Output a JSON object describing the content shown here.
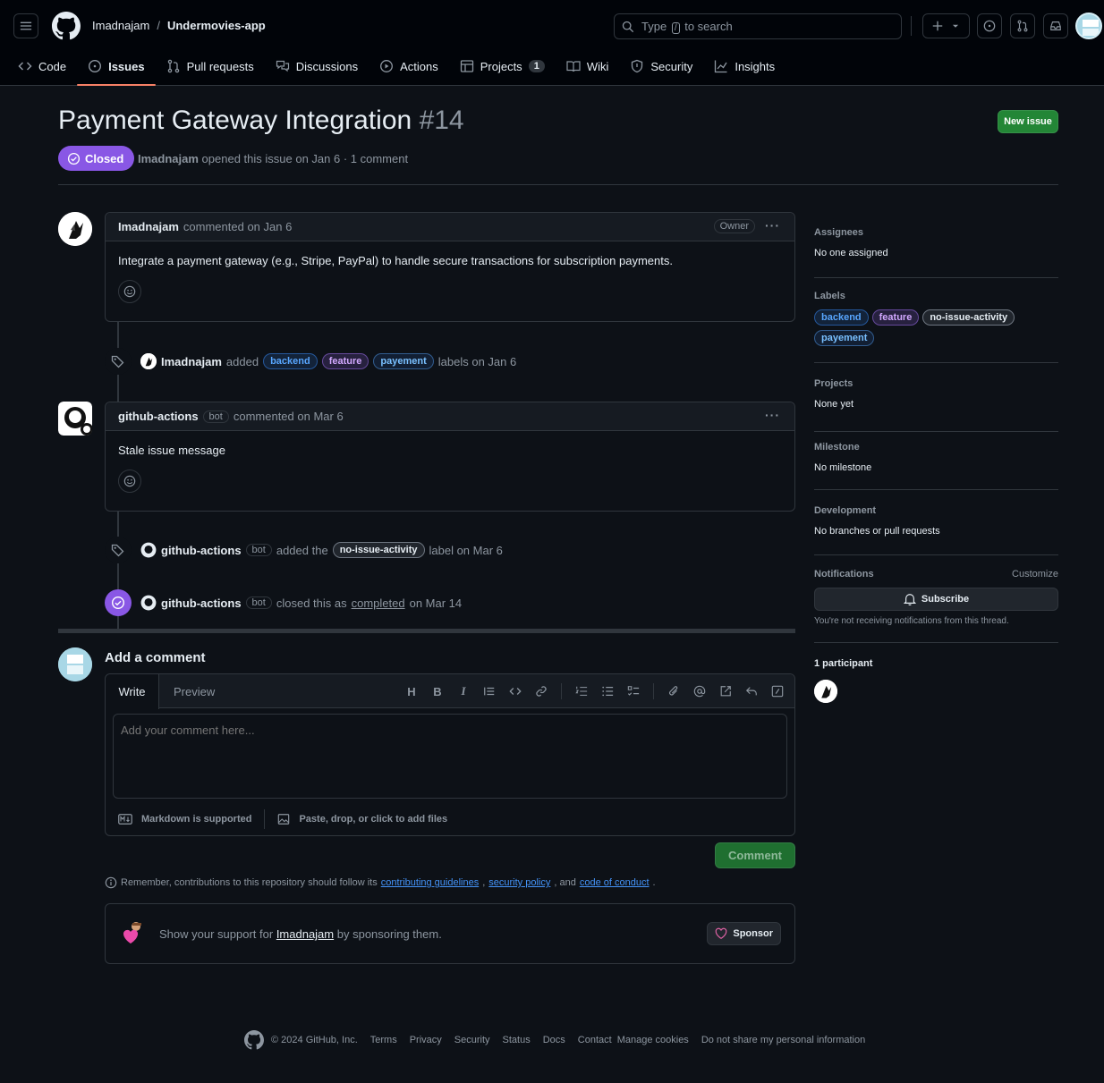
{
  "header": {
    "owner": "Imadnajam",
    "separator": "/",
    "repo": "Undermovies-app",
    "search_prefix": "Type",
    "search_key": "/",
    "search_suffix": "to search"
  },
  "repo_nav": [
    {
      "label": "Code",
      "icon": "code-icon"
    },
    {
      "label": "Issues",
      "icon": "issue-opened-icon",
      "active": true
    },
    {
      "label": "Pull requests",
      "icon": "git-pull-request-icon"
    },
    {
      "label": "Discussions",
      "icon": "comment-discussion-icon"
    },
    {
      "label": "Actions",
      "icon": "play-icon"
    },
    {
      "label": "Projects",
      "icon": "table-icon",
      "count": "1"
    },
    {
      "label": "Wiki",
      "icon": "book-icon"
    },
    {
      "label": "Security",
      "icon": "shield-icon"
    },
    {
      "label": "Insights",
      "icon": "graph-icon"
    }
  ],
  "issue": {
    "title": "Payment Gateway Integration",
    "number": "#14",
    "new_issue_label": "New issue",
    "state": "Closed",
    "meta_author": "Imadnajam",
    "meta_rest": "opened this issue on Jan 6 · 1 comment"
  },
  "timeline": {
    "first_comment": {
      "author": "Imadnajam",
      "when": "commented on Jan 6",
      "role": "Owner",
      "body": "Integrate a payment gateway (e.g., Stripe, PayPal) to handle secure transactions for subscription payments."
    },
    "labels_event": {
      "actor": "Imadnajam",
      "verb": "added",
      "labels": [
        "backend",
        "feature",
        "payement"
      ],
      "tail": "labels on Jan 6"
    },
    "bot_comment": {
      "author": "github-actions",
      "badge": "bot",
      "when": "commented on Mar 6",
      "body": "Stale issue message"
    },
    "stale_event": {
      "actor": "github-actions",
      "badge": "bot",
      "verb": "added the",
      "label": "no-issue-activity",
      "tail": "label on Mar 6"
    },
    "closed_event": {
      "actor": "github-actions",
      "badge": "bot",
      "verb": "closed this as",
      "reason": "completed",
      "tail": "on Mar 14"
    }
  },
  "composer": {
    "title": "Add a comment",
    "tab_write": "Write",
    "tab_preview": "Preview",
    "placeholder": "Add your comment here...",
    "markdown_note": "Markdown is supported",
    "attach_note": "Paste, drop, or click to add files",
    "submit_label": "Comment",
    "heading_glyph": "H",
    "bold_glyph": "B",
    "italic_glyph": "I"
  },
  "contrib_note": {
    "prefix": "Remember, contributions to this repository should follow its",
    "link1": "contributing guidelines",
    "comma1": ",",
    "link2": "security policy",
    "and": ", and",
    "link3": "code of conduct",
    "end": "."
  },
  "sponsor": {
    "prefix": "Show your support for",
    "user": "Imadnajam",
    "suffix": "by sponsoring them.",
    "button": "Sponsor"
  },
  "sidebar": {
    "assignees_h": "Assignees",
    "assignees_v": "No one assigned",
    "labels_h": "Labels",
    "labels": [
      "backend",
      "feature",
      "no-issue-activity",
      "payement"
    ],
    "projects_h": "Projects",
    "projects_v": "None yet",
    "milestone_h": "Milestone",
    "milestone_v": "No milestone",
    "development_h": "Development",
    "development_v": "No branches or pull requests",
    "notifications_h": "Notifications",
    "customize": "Customize",
    "subscribe": "Subscribe",
    "notif_note": "You're not receiving notifications from this thread.",
    "participants_h": "1 participant"
  },
  "footer": {
    "copyright": "© 2024 GitHub, Inc.",
    "links": [
      "Terms",
      "Privacy",
      "Security",
      "Status",
      "Docs",
      "Contact",
      "Manage cookies",
      "Do not share my personal information"
    ]
  },
  "colors": {
    "bg": "#0d1117",
    "header_bg": "#010409",
    "closed_purple": "#8957e5",
    "green": "#238636",
    "accent_underline": "#f78166"
  }
}
